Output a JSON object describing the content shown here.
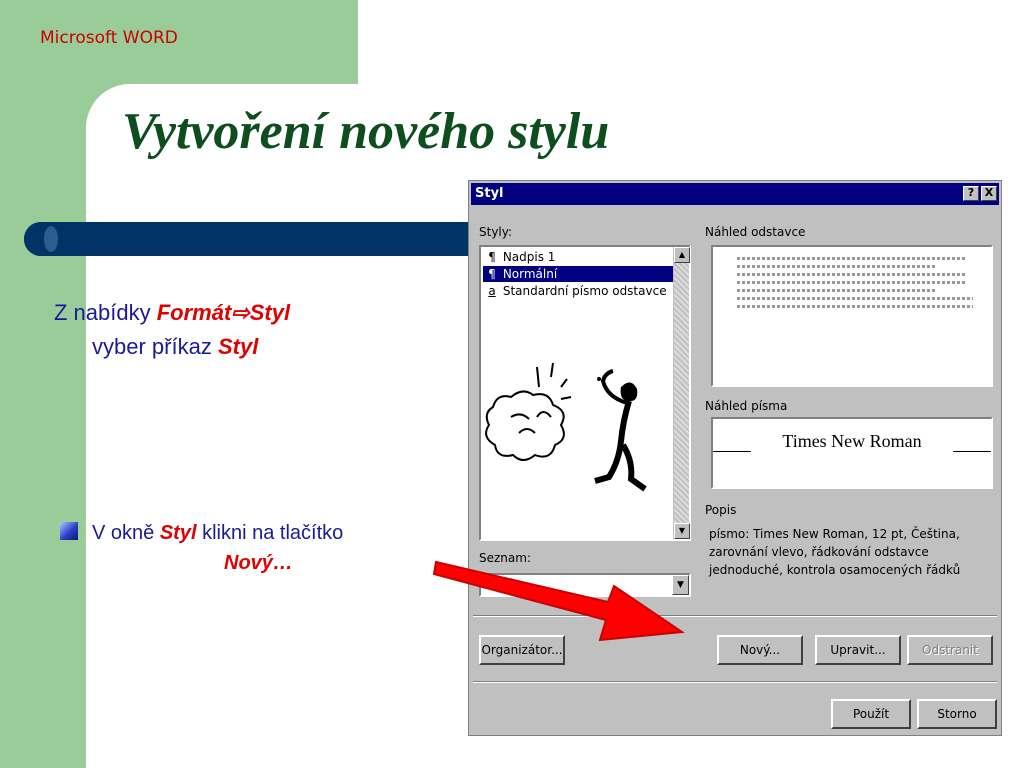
{
  "slide": {
    "brand": "Microsoft WORD",
    "title": "Vytvoření nového stylu",
    "instruction": {
      "prefix": "Z nabídky",
      "menu_path_1": "Formát",
      "arrow": "⇨",
      "menu_path_2": "Styl",
      "line2_prefix": "vyber příkaz",
      "command": "Styl"
    },
    "bullet": {
      "prefix": "V okně",
      "window_name": "Styl",
      "middle": "klikni na tlačítko",
      "button_name": "Nový…"
    },
    "colors": {
      "green": "#99cc99",
      "title": "#0d4d1e",
      "band": "#003366",
      "text": "#1a1a99",
      "accent": "#e00000",
      "dialog_title": "#000080"
    }
  },
  "dialog": {
    "title": "Styl",
    "help_button": "?",
    "close_button": "X",
    "styles_label": "Styly:",
    "styles_list": [
      {
        "marker": "¶",
        "label": "Nadpis 1"
      },
      {
        "marker": "¶",
        "label": "Normální"
      },
      {
        "marker": "a",
        "label": "Standardní písmo odstavce"
      }
    ],
    "list_label": "Seznam:",
    "list_value": "Stylů",
    "paragraph_preview_label": "Náhled odstavce",
    "font_preview_label": "Náhled písma",
    "font_preview_text": "Times New Roman",
    "description_label": "Popis",
    "description_text": "písmo: Times New Roman, 12 pt, Čeština, zarovnání vlevo, řádkování odstavce jednoduché, kontrola osamocených řádků",
    "buttons": {
      "organizer": "Organizátor...",
      "new": "Nový...",
      "modify": "Upravit...",
      "delete": "Odstranit",
      "apply": "Použít",
      "cancel": "Storno"
    }
  }
}
